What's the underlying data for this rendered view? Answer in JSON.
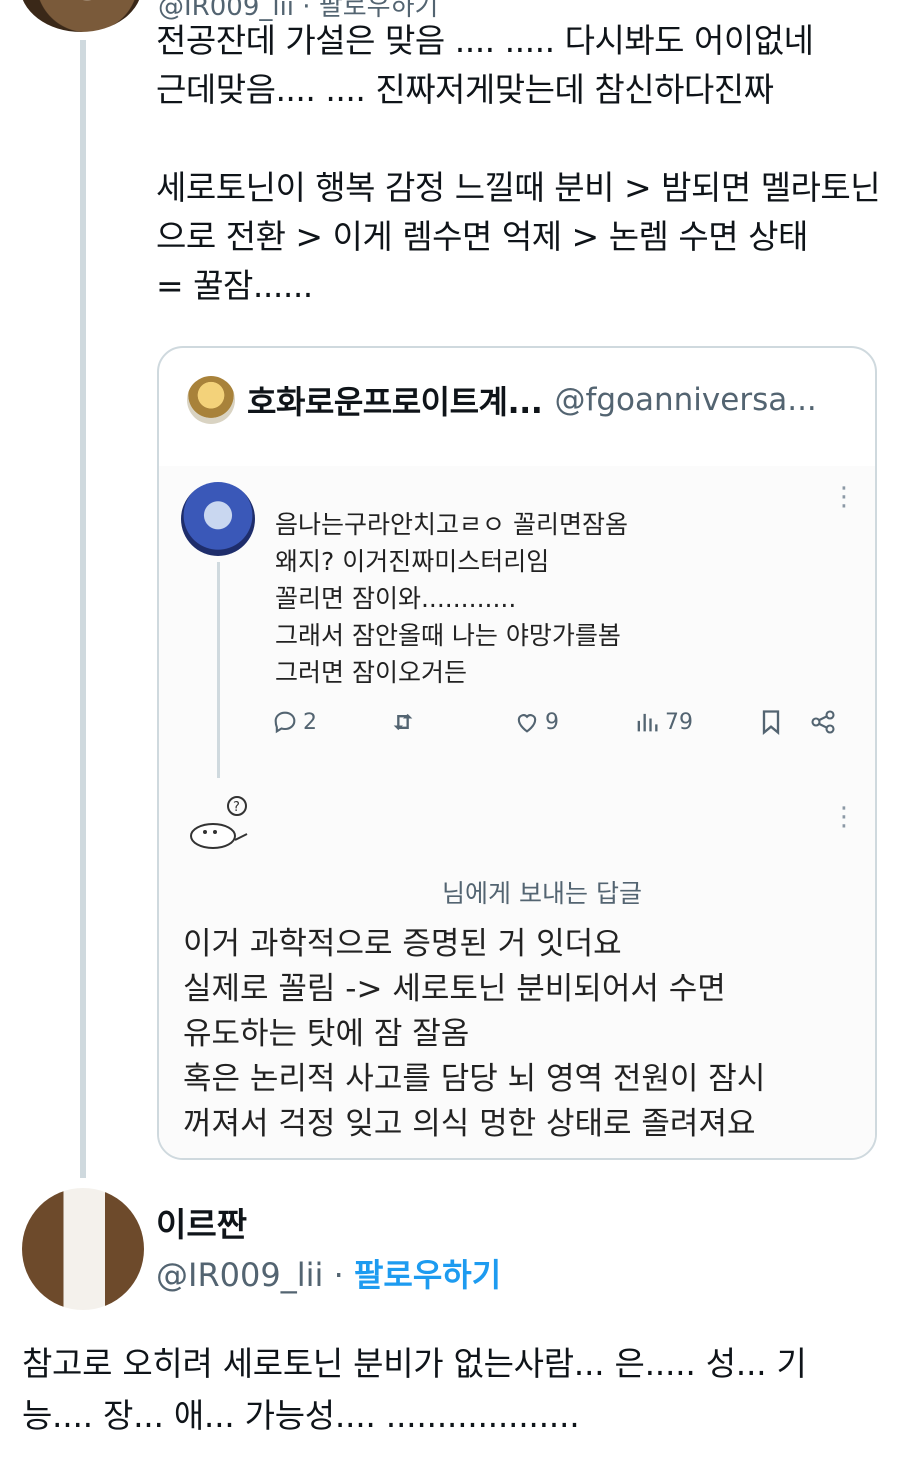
{
  "top_tweet": {
    "header_partial": "@IR009_lii · 팔로우하기",
    "text": "전공잔데 가설은 맞음 .... ..... 다시봐도 어이없네\n근데맞음.... .... 진짜저게맞는데 참신하다진짜\n\n세로토닌이 행복 감정 느낄때 분비 > 밤되면 멜라토닌으로 전환 > 이게 렘수면 억제 > 논렘 수면 상태\n= 꿀잠......"
  },
  "quote": {
    "name": "호화로운프로이트계...",
    "handle": "@fgoanniversa...",
    "inner_post": {
      "text": "음나는구라안치고ㄹㅇ 꼴리면잠옴\n왜지? 이거진짜미스터리임\n꼴리면 잠이와............\n그래서 잠안올때 나는 야망가를봄\n그러면 잠이오거든",
      "replies": "2",
      "retweets": "",
      "likes": "9",
      "views": "79"
    },
    "reply": {
      "reply_to": "님에게 보내는 답글",
      "text": "이거 과학적으로 증명된 거 잇더요\n실제로 꼴림 -> 세로토닌 분비되어서 수면\n유도하는 탓에 잠 잘옴\n혹은 논리적 사고를 담당 뇌 영역 전원이 잠시\n꺼져서 걱정 잊고 의식 멍한 상태로 졸려져요"
    }
  },
  "bottom_tweet": {
    "name": "이르짠",
    "handle": "@IR009_lii",
    "separator": " · ",
    "follow_label": "팔로우하기",
    "text": "참고로 오히려 세로토닌 분비가 없는사람... 은..... 성... 기\n능.... 장... 애... 가능성.... ..................."
  },
  "colors": {
    "accent": "#1d9bf0",
    "muted": "#536471",
    "border": "#cfd9de"
  },
  "icons": [
    "reply-icon",
    "retweet-icon",
    "like-icon",
    "views-icon",
    "bookmark-icon",
    "share-icon",
    "more-icon"
  ]
}
